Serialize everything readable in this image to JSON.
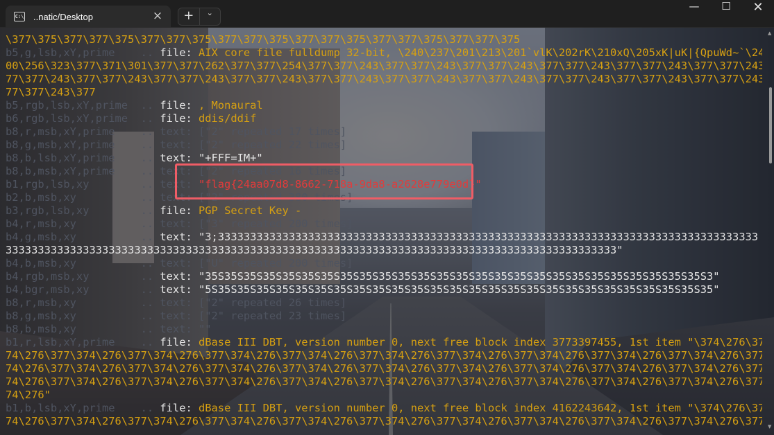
{
  "window": {
    "tab_title": "..natic/Desktop",
    "tab_icon": "terminal-icon",
    "tab_close": "×",
    "new_tab": "+",
    "dropdown": "⌄",
    "minimize": "—",
    "maximize": "☐",
    "close": "✕"
  },
  "terminal": {
    "lines": [
      {
        "g": "",
        "w": "",
        "y": "\\377\\375\\377\\377\\375\\377\\377\\375\\377\\377\\375\\377\\377\\375\\377\\377\\375\\377\\377\\375",
        "r": ""
      },
      {
        "g": "b5,g,lsb,xY,prime    .. ",
        "w": "file: ",
        "y": "AIX core file fulldump 32-bit, \\240\\237\\201\\213\\201`vlK\\202rK\\210xQ\\205xK|uK|{QpuWd~`\\240\\3",
        "r": ""
      },
      {
        "g": "",
        "w": "",
        "y": "00\\256\\323\\377\\371\\301\\377\\377\\262\\377\\377\\254\\377\\377\\243\\377\\377\\243\\377\\377\\243\\377\\377\\243\\377\\377\\243\\377\\377\\243\\3",
        "r": ""
      },
      {
        "g": "",
        "w": "",
        "y": "77\\377\\243\\377\\377\\243\\377\\377\\243\\377\\377\\243\\377\\377\\243\\377\\377\\243\\377\\377\\243\\377\\377\\243\\377\\377\\243\\377\\377\\243\\3",
        "r": ""
      },
      {
        "g": "",
        "w": "",
        "y": "77\\377\\243\\377",
        "r": ""
      },
      {
        "g": "b5,rgb,lsb,xY,prime  .. ",
        "w": "file: ",
        "y": ", Monaural",
        "r": ""
      },
      {
        "g": "b6,rgb,lsb,xY,prime  .. ",
        "w": "file: ",
        "y": "ddis/ddif",
        "r": ""
      },
      {
        "g": "b8,r,msb,xY,prime    .. text: [\"2\" repeated 17 times]",
        "w": "",
        "y": "",
        "r": ""
      },
      {
        "g": "b8,g,msb,xY,prime    .. text: [\"2\" repeated 22 times]",
        "w": "",
        "y": "",
        "r": ""
      },
      {
        "g": "b8,b,lsb,xY,prime    .. ",
        "w": "text: \"+FFF=IM+\"",
        "y": "",
        "r": ""
      },
      {
        "g": "b8,b,msb,xY,prime    .. text: [\"2\" repeated 16 times]",
        "w": "",
        "y": "",
        "r": ""
      },
      {
        "g": "b1,rgb,lsb,xy        .. text: ",
        "w": "",
        "y": "",
        "r": "\"flag{24aa07d8-8662-718a-9da8-a2628e779e0d}\""
      },
      {
        "g": "b2,b,msb,xy          .. text: [\"2\" repeated 380 times]",
        "w": "",
        "y": "",
        "r": ""
      },
      {
        "g": "b3,rgb,lsb,xy        .. ",
        "w": "file: ",
        "y": "PGP Secret Key -",
        "r": ""
      },
      {
        "g": "b4,r,msb,xy          .. text: [\"3\" repeated 200 times]",
        "w": "",
        "y": "",
        "r": ""
      },
      {
        "g": "b4,g,msb,xy          .. ",
        "w": "text: \"3;333333333333333333333333333333333333333333333333333333333333333333333333333333333333",
        "y": "",
        "r": ""
      },
      {
        "g": "",
        "w": "33333333333333333333333333333333333333333333333333333333333333333333333333333333333333333333333\"",
        "y": "",
        "r": ""
      },
      {
        "g": "b4,b,msb,xy          .. text: [\"U\" repeated 200 times]",
        "w": "",
        "y": "",
        "r": ""
      },
      {
        "g": "b4,rgb,msb,xy        .. ",
        "w": "text: \"35S35S35S35S35S35S35S35S35S35S35S35S35S35S35S35S35S35S35S35S35S35S35S35S35S35S3\"",
        "y": "",
        "r": ""
      },
      {
        "g": "b4,bgr,msb,xy        .. ",
        "w": "text: \"5S35S35S35S35S35S35S35S35S35S35S35S35S35S35S35S35S35S35S35S35S35S35S35S35S35S35\"",
        "y": "",
        "r": ""
      },
      {
        "g": "b8,r,msb,xy          .. text: [\"2\" repeated 26 times]",
        "w": "",
        "y": "",
        "r": ""
      },
      {
        "g": "b8,g,msb,xy          .. text: [\"2\" repeated 23 times]",
        "w": "",
        "y": "",
        "r": ""
      },
      {
        "g": "b8,b,msb,xy          .. text: \"\"",
        "w": "",
        "y": "",
        "r": ""
      },
      {
        "g": "b1,r,lsb,xY,prime    .. ",
        "w": "file: ",
        "y": "dBase III DBT, version number 0, next free block index 3773397455, 1st item \"\\374\\276\\377\\3",
        "r": ""
      },
      {
        "g": "",
        "w": "",
        "y": "74\\276\\377\\374\\276\\377\\374\\276\\377\\374\\276\\377\\374\\276\\377\\374\\276\\377\\374\\276\\377\\374\\276\\377\\374\\276\\377\\374\\276\\377\\3",
        "r": ""
      },
      {
        "g": "",
        "w": "",
        "y": "74\\276\\377\\374\\276\\377\\374\\276\\377\\374\\276\\377\\374\\276\\377\\374\\276\\377\\374\\276\\377\\374\\276\\377\\374\\276\\377\\374\\276\\377\\3",
        "r": ""
      },
      {
        "g": "",
        "w": "",
        "y": "74\\276\\377\\374\\276\\377\\374\\276\\377\\374\\276\\377\\374\\276\\377\\374\\276\\377\\374\\276\\377\\374\\276\\377\\374\\276\\377\\374\\276\\377\\3",
        "r": ""
      },
      {
        "g": "",
        "w": "",
        "y": "74\\276\"",
        "r": ""
      },
      {
        "g": "b1,b,lsb,xY,prime    .. ",
        "w": "file: ",
        "y": "dBase III DBT, version number 0, next free block index 4162243642, 1st item \"\\374\\276\\377\\3",
        "r": ""
      },
      {
        "g": "",
        "w": "",
        "y": "74\\276\\377\\374\\276\\377\\374\\276\\377\\374\\276\\377\\374\\276\\377\\374\\276\\377\\374\\276\\377\\374\\276\\377\\374\\276\\377\\374\\276\\377\\3",
        "r": ""
      }
    ]
  }
}
